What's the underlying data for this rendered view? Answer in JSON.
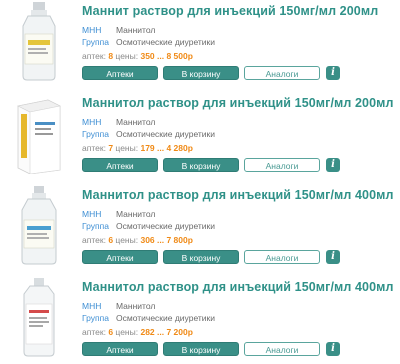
{
  "labels": {
    "mnn": "МНН",
    "group": "Группа",
    "pharmacies": "аптек:",
    "prices": "цены:",
    "btn_pharmacies": "Аптеки",
    "btn_cart": "В корзину",
    "btn_analogs": "Аналоги",
    "info": "i"
  },
  "items": [
    {
      "title": "Маннит раствор для инъекций 150мг/мл 200мл",
      "mnn": "Маннитол",
      "group": "Осмотические диуретики",
      "pharmacy_count": "8",
      "price_range": "350 ... 8 500р",
      "image": "glass-bottle-icon"
    },
    {
      "title": "Маннитол раствор для инъекций 150мг/мл 200мл",
      "mnn": "Маннитол",
      "group": "Осмотические диуретики",
      "pharmacy_count": "7",
      "price_range": "179 ... 4 280р",
      "image": "medicine-box-icon"
    },
    {
      "title": "Маннитол раствор для инъекций 150мг/мл 400мл",
      "mnn": "Маннитол",
      "group": "Осмотические диуретики",
      "pharmacy_count": "6",
      "price_range": "306 ... 7 800р",
      "image": "glass-bottle-icon"
    },
    {
      "title": "Маннитол раствор для инъекций 150мг/мл 400мл",
      "mnn": "Маннитол",
      "group": "Осмотические диуретики",
      "pharmacy_count": "6",
      "price_range": "282 ... 7 200р",
      "image": "plastic-bottle-icon"
    }
  ]
}
